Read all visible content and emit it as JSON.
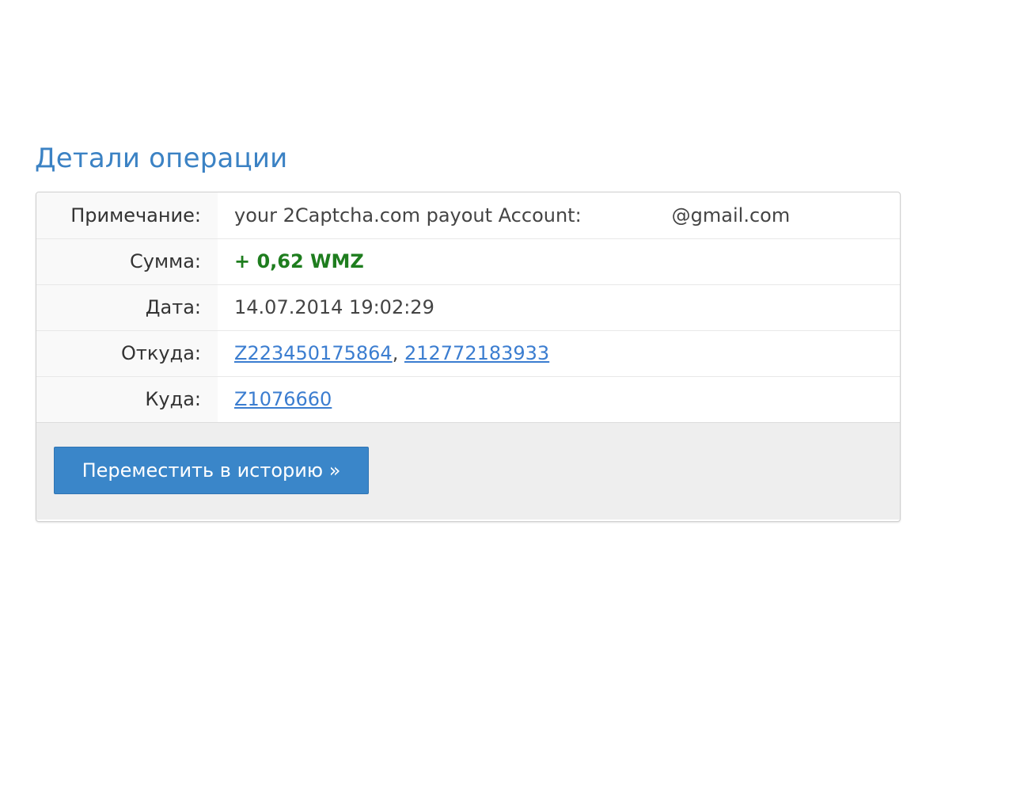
{
  "page": {
    "title": "Детали операции"
  },
  "details": {
    "note": {
      "label": "Примечание:",
      "value": "your 2Captcha.com payout Account:",
      "email_suffix": "@gmail.com"
    },
    "amount": {
      "label": "Сумма:",
      "value": "+ 0,62 WMZ",
      "color": "#1e7d1e"
    },
    "date": {
      "label": "Дата:",
      "value": "14.07.2014 19:02:29"
    },
    "from": {
      "label": "Откуда:",
      "wallets": [
        "Z223450175864",
        "212772183933"
      ],
      "separator": ","
    },
    "to": {
      "label": "Куда:",
      "wallet": "Z1076660"
    }
  },
  "footer": {
    "move_button_label": "Переместить в историю »",
    "accent_color": "#3a86c9"
  }
}
